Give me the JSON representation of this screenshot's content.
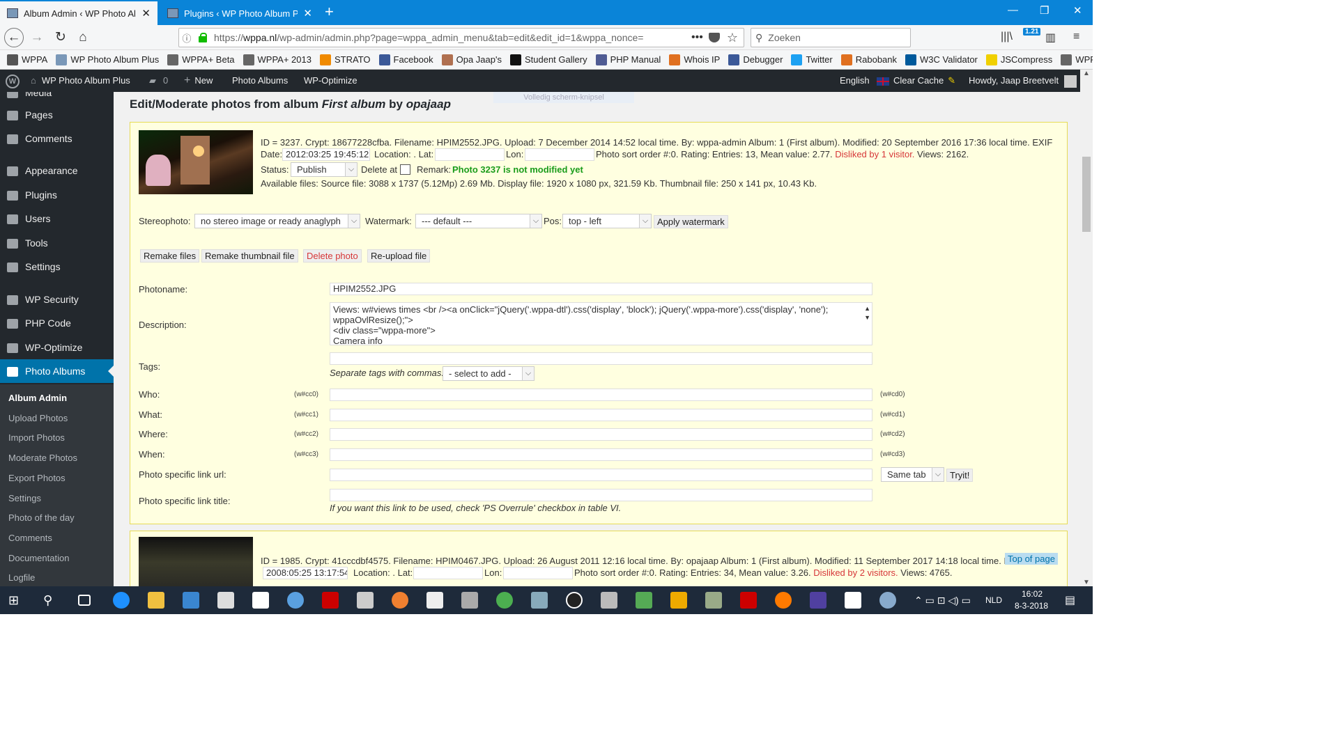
{
  "browser": {
    "tabs": [
      {
        "title": "Album Admin ‹ WP Photo Albu",
        "close": "✕"
      },
      {
        "title": "Plugins ‹ WP Photo Album Plus",
        "close": "✕"
      }
    ],
    "new_tab": "+",
    "window_controls": [
      "—",
      "❐",
      "✕"
    ],
    "url_prefix": "https://",
    "url_host": "wppa.nl",
    "url_rest": "/wp-admin/admin.php?page=wppa_admin_menu&tab=edit&edit_id=1&wppa_nonce=",
    "url_dots": "•••",
    "search_placeholder": "Zoeken",
    "library_badge": "1.21",
    "bookmarks": [
      {
        "label": "WPPA",
        "color": "#555"
      },
      {
        "label": "WP Photo Album Plus",
        "color": "#7a98b8"
      },
      {
        "label": "WPPA+ Beta",
        "color": "#666"
      },
      {
        "label": "WPPA+ 2013",
        "color": "#666"
      },
      {
        "label": "STRATO",
        "color": "#f08a00"
      },
      {
        "label": "Facebook",
        "color": "#3b5998"
      },
      {
        "label": "Opa Jaap's",
        "color": "#b07050"
      },
      {
        "label": "Student Gallery",
        "color": "#111"
      },
      {
        "label": "PHP Manual",
        "color": "#4f5b93"
      },
      {
        "label": "Whois IP",
        "color": "#e07020"
      },
      {
        "label": "Debugger",
        "color": "#3b5998"
      },
      {
        "label": "Twitter",
        "color": "#1da1f2"
      },
      {
        "label": "Rabobank",
        "color": "#e07020"
      },
      {
        "label": "W3C Validator",
        "color": "#005a9c"
      },
      {
        "label": "JSCompress",
        "color": "#f0d000"
      },
      {
        "label": "WPPA Translate",
        "color": "#666"
      }
    ]
  },
  "adminbar": {
    "site": "WP Photo Album Plus",
    "comments": "0",
    "new": "New",
    "photo_albums": "Photo Albums",
    "wp_optimize": "WP-Optimize",
    "language": "English",
    "clear_cache": "Clear Cache",
    "howdy": "Howdy, Jaap Breetvelt"
  },
  "sidebar": {
    "items": [
      {
        "label": "Media"
      },
      {
        "label": "Pages"
      },
      {
        "label": "Comments"
      },
      {
        "label": "Appearance"
      },
      {
        "label": "Plugins"
      },
      {
        "label": "Users"
      },
      {
        "label": "Tools"
      },
      {
        "label": "Settings"
      },
      {
        "label": "WP Security"
      },
      {
        "label": "PHP Code"
      },
      {
        "label": "WP-Optimize"
      },
      {
        "label": "Photo Albums"
      }
    ],
    "submenu": [
      "Album Admin",
      "Upload Photos",
      "Import Photos",
      "Moderate Photos",
      "Export Photos",
      "Settings",
      "Photo of the day",
      "Comments",
      "Documentation",
      "Logfile"
    ]
  },
  "page": {
    "title_prefix": "Edit/Moderate photos from album ",
    "album_name": "First album",
    "title_by": " by ",
    "owner": "opajaap",
    "snip_hint": "Volledig scherm-knipsel"
  },
  "photo1": {
    "line1": "ID = 3237. Crypt: 18677228cfba. Filename: HPIM2552.JPG. Upload: 7 December 2014 14:52 local time. By: wppa-admin Album: 1 (First album). Modified: 20 September 2016 17:36 local time. EXIF",
    "date_label": "Date:",
    "date_value": "2012:03:25 19:45:12",
    "location_label": "Location: . Lat:",
    "lon_label": "Lon:",
    "stats": "Photo sort order #:0. Rating: Entries: 13, Mean value: 2.77.",
    "disliked": "Disliked by 1 visitor.",
    "views": "Views: 2162.",
    "status_label": "Status:",
    "status_value": "Publish",
    "delete_at": "Delete at",
    "remark_label": "Remark:",
    "remark_value": "Photo 3237 is not modified yet",
    "files": "Available files: Source file: 3088 x 1737 (5.12Mp) 2.69 Mb. Display file: 1920 x 1080 px, 321.59 Kb. Thumbnail file: 250 x 141 px, 10.43 Kb.",
    "stereo_label": "Stereophoto:",
    "stereo_value": "no stereo image or ready anaglyph",
    "watermark_label": "Watermark:",
    "watermark_value": "--- default ---",
    "pos_label": "Pos:",
    "pos_value": "top - left",
    "apply_watermark": "Apply watermark",
    "remake_files": "Remake files",
    "remake_thumb": "Remake thumbnail file",
    "delete_photo": "Delete photo",
    "reupload": "Re-upload file",
    "photoname_label": "Photoname:",
    "photoname_value": "HPIM2552.JPG",
    "description_label": "Description:",
    "description_lines": [
      "Views: w#views times <br /><a onClick=\"jQuery('.wppa-dtl').css('display', 'block'); jQuery('.wppa-more').css('display', 'none');",
      "wppaOvlResize();\">",
      "<div class=\"wppa-more\">",
      "Camera info"
    ],
    "tags_label": "Tags:",
    "tags_hint": "Separate tags with commas.",
    "tags_select": "- select to add -",
    "custom": [
      {
        "label": "Who:",
        "code": "(w#cc0)",
        "code2": "(w#cd0)"
      },
      {
        "label": "What:",
        "code": "(w#cc1)",
        "code2": "(w#cd1)"
      },
      {
        "label": "Where:",
        "code": "(w#cc2)",
        "code2": "(w#cd2)"
      },
      {
        "label": "When:",
        "code": "(w#cc3)",
        "code2": "(w#cd3)"
      }
    ],
    "link_url_label": "Photo specific link url:",
    "link_target": "Same tab",
    "tryit": "Tryit!",
    "link_title_label": "Photo specific link title:",
    "link_hint": "If you want this link to be used, check 'PS Overrule' checkbox in table VI."
  },
  "photo2": {
    "line1": "ID = 1985. Crypt: 41cccdbf4575. Filename: HPIM0467.JPG. Upload: 26 August 2011 12:16 local time. By: opajaap Album: 1 (First album). Modified: 11 September 2017 14:18 local time. E",
    "date_value": "2008:05:25 13:17:54",
    "location_label": "Location: . Lat:",
    "lon_label": "Lon:",
    "stats": "Photo sort order #:0. Rating: Entries: 34, Mean value: 3.26.",
    "disliked": "Disliked by 2 visitors.",
    "views": "Views: 4765."
  },
  "top_of_page": "Top of page",
  "taskbar": {
    "lang": "NLD",
    "time": "16:02",
    "date": "8-3-2018"
  }
}
